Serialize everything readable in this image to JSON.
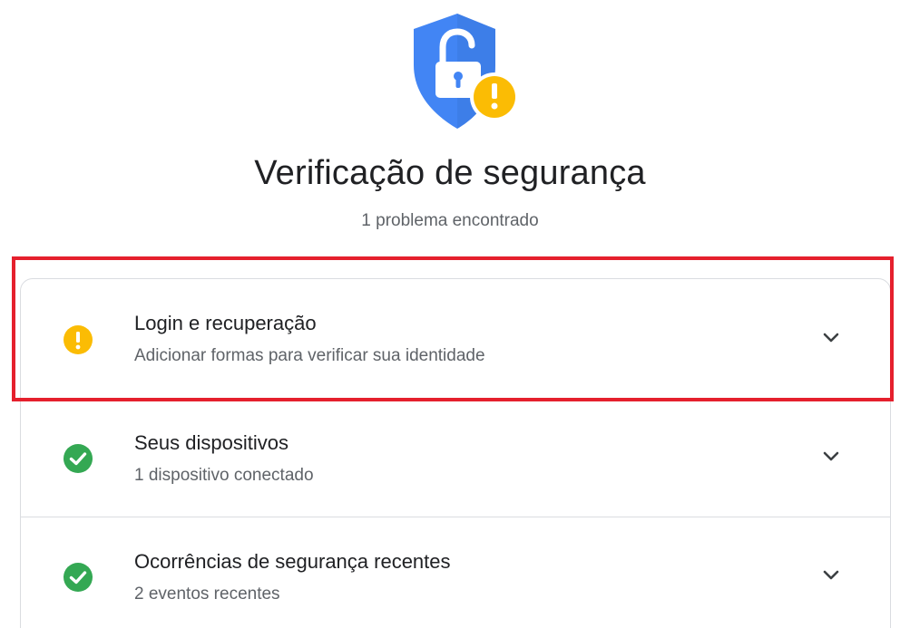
{
  "header": {
    "icon": "shield-lock-warning-icon",
    "title": "Verificação de segurança",
    "subtitle": "1 problema encontrado"
  },
  "items": [
    {
      "title": "Login e recuperação",
      "description": "Adicionar formas para verificar sua identidade",
      "status": "warning",
      "status_icon": "warning-icon",
      "expand_icon": "chevron-down-icon",
      "highlighted": true
    },
    {
      "title": "Seus dispositivos",
      "description": "1 dispositivo conectado",
      "status": "ok",
      "status_icon": "check-circle-icon",
      "expand_icon": "chevron-down-icon"
    },
    {
      "title": "Ocorrências de segurança recentes",
      "description": "2 eventos recentes",
      "status": "ok",
      "status_icon": "check-circle-icon",
      "expand_icon": "chevron-down-icon"
    }
  ],
  "colors": {
    "shield_blue": "#4285f4",
    "warning_yellow": "#fbbc04",
    "ok_green": "#34a853",
    "highlight_red": "#e5202d"
  }
}
